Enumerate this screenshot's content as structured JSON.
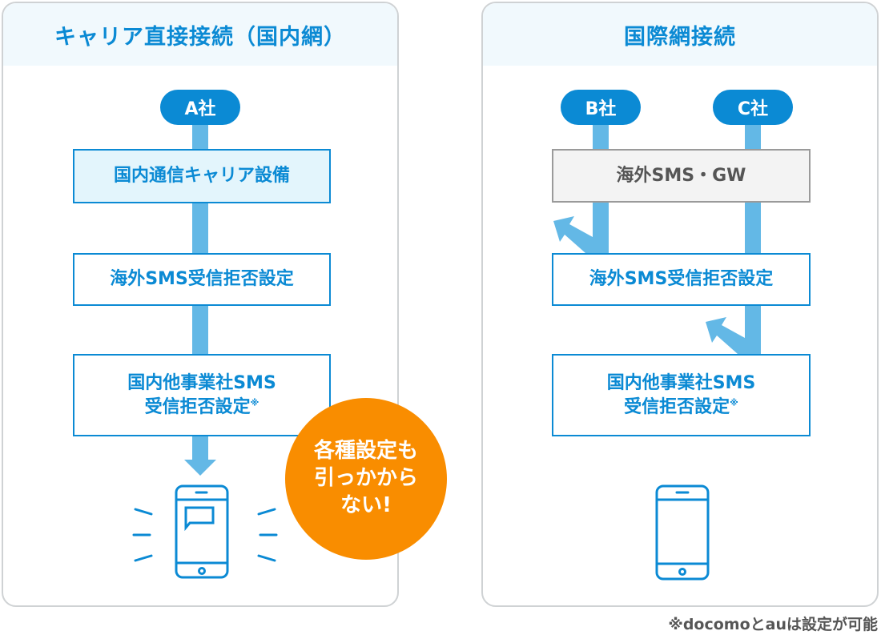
{
  "left_panel": {
    "title": "キャリア直接接続（国内網）",
    "source": "A社",
    "steps": [
      "国内通信キャリア設備",
      "海外SMS受信拒否設定",
      "国内他事業社SMS",
      "受信拒否設定"
    ],
    "step3_mark": "※",
    "badge_lines": [
      "各種設定も",
      "引っかから",
      "ない!"
    ]
  },
  "right_panel": {
    "title": "国際網接続",
    "sources": [
      "B社",
      "C社"
    ],
    "gateway": "海外SMS・GW",
    "steps": [
      "海外SMS受信拒否設定",
      "国内他事業社SMS",
      "受信拒否設定"
    ],
    "step3_mark": "※"
  },
  "footnote": "※docomoとauは設定が可能",
  "colors": {
    "primary": "#0b8ad4",
    "flow": "#63b8e6",
    "accent": "#f98d00",
    "header_bg": "#f1f9fd"
  }
}
